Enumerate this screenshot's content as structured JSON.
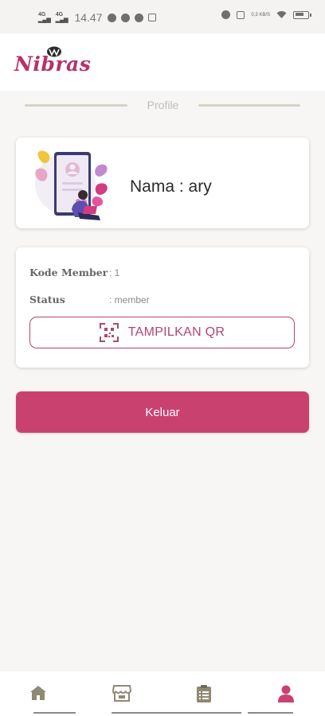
{
  "status_bar": {
    "net1": "4G",
    "net2": "4G",
    "time": "14.47",
    "speed": "0,3 KB/S"
  },
  "app": {
    "brand": "Nibras"
  },
  "page": {
    "section_title": "Profile"
  },
  "profile": {
    "name_text": "Nama : ary"
  },
  "member": {
    "code_label": "Kode Member",
    "code_value": ": 1",
    "status_label": "Status",
    "status_value": ": member",
    "qr_button_label": "TAMPILKAN QR"
  },
  "actions": {
    "logout_label": "Keluar"
  },
  "bottom_nav": {
    "items": [
      {
        "icon": "home-icon",
        "active": false
      },
      {
        "icon": "store-icon",
        "active": false
      },
      {
        "icon": "clipboard-icon",
        "active": false
      },
      {
        "icon": "person-icon",
        "active": true
      }
    ]
  },
  "colors": {
    "accent": "#c9426f",
    "brand": "#b8306a",
    "nav_inactive": "#8e8a74"
  }
}
